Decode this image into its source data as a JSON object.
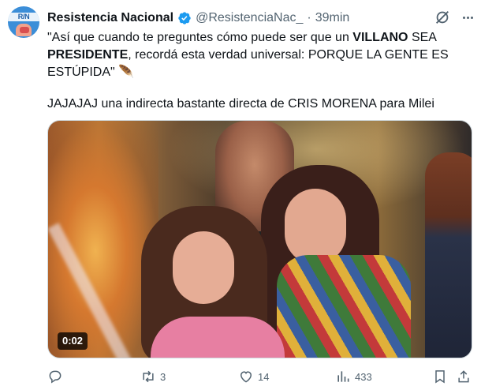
{
  "tweet": {
    "author_name": "Resistencia Nacional",
    "avatar_text": "R/N",
    "handle": "@ResistenciaNac_",
    "separator": "·",
    "time": "39min",
    "text_part1": "\"Así que cuando te preguntes cómo puede ser que un ",
    "text_bold1": "VILLANO",
    "text_part2": " SEA ",
    "text_bold2": "PRESIDENTE",
    "text_part3": ", recordá esta verdad universal: PORQUE LA GENTE ES ESTÚPIDA\" 🪶",
    "text_paragraph2": "JAJAJAJ una indirecta bastante directa de CRIS MORENA para Milei",
    "media": {
      "duration": "0:02"
    }
  },
  "actions": {
    "replies": "",
    "retweets": "3",
    "likes": "14",
    "views": "433"
  },
  "colors": {
    "text": "#0f1419",
    "secondary": "#536471",
    "verified": "#1d9bf0"
  }
}
